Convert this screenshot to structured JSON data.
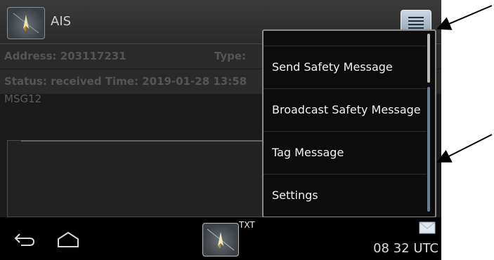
{
  "app": {
    "title": "AIS"
  },
  "message": {
    "address": "Address: 203117231",
    "type_label": "Type:",
    "status": "Status: received Time: 2019-01-28 13:58",
    "body": "MSG12"
  },
  "menu": {
    "items": [
      {
        "label": "Send Safety Message"
      },
      {
        "label": "Broadcast Safety Message"
      },
      {
        "label": "Tag Message"
      },
      {
        "label": "Settings"
      }
    ]
  },
  "navbar": {
    "app_badge": "TXT",
    "clock": "08 32 UTC"
  },
  "icons": {
    "app": "compass-icon",
    "menu": "menu-icon",
    "back": "back-icon",
    "home": "home-icon",
    "notification": "envelope-icon"
  }
}
